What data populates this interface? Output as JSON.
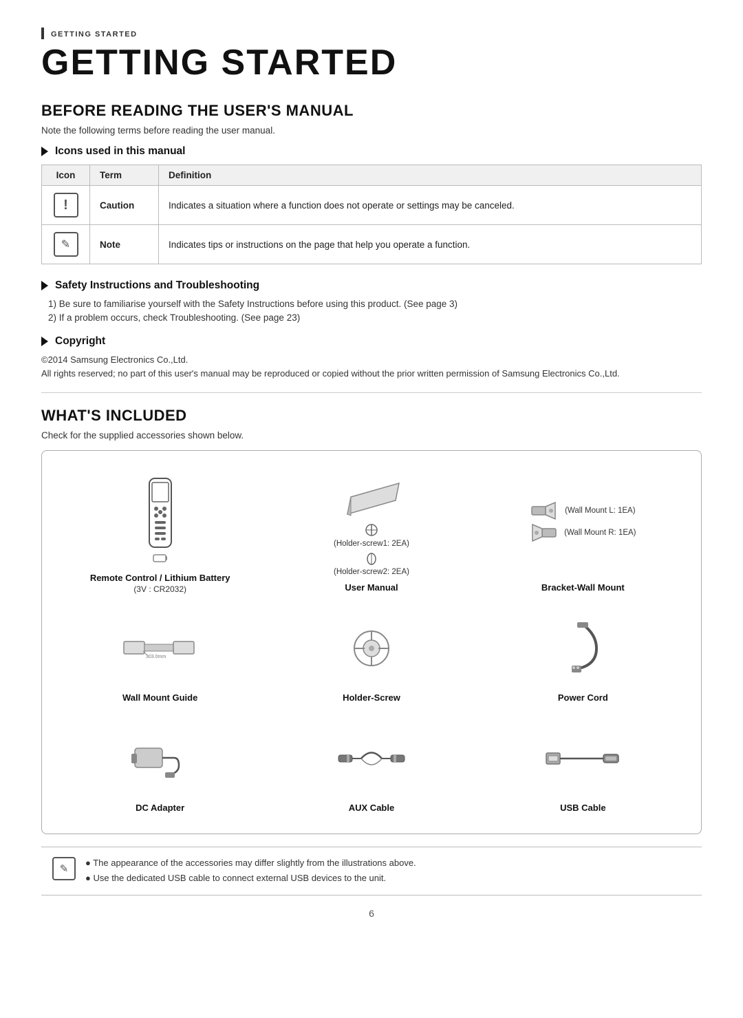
{
  "breadcrumb": "Getting Started",
  "page_title": "GETTING STARTED",
  "section1": {
    "title": "BEFORE READING THE USER'S MANUAL",
    "note": "Note the following terms before reading the user manual.",
    "icons_section": {
      "heading": "Icons used in this manual",
      "table": {
        "col_icon": "Icon",
        "col_term": "Term",
        "col_def": "Definition",
        "rows": [
          {
            "icon": "caution",
            "term": "Caution",
            "definition": "Indicates a situation where a function does not operate or settings may be canceled."
          },
          {
            "icon": "note",
            "term": "Note",
            "definition": "Indicates tips or instructions on the page that help you operate a function."
          }
        ]
      }
    },
    "safety_section": {
      "heading": "Safety Instructions and Troubleshooting",
      "items": [
        "1)  Be sure to familiarise yourself with the Safety Instructions before using this product. (See page 3)",
        "2)  If a problem occurs, check Troubleshooting. (See page 23)"
      ]
    },
    "copyright_section": {
      "heading": "Copyright",
      "line1": "©2014 Samsung Electronics Co.,Ltd.",
      "line2": "All rights reserved; no part of this user's manual may be reproduced or copied without the prior written permission of Samsung Electronics Co.,Ltd."
    }
  },
  "section2": {
    "title": "WHAT'S INCLUDED",
    "note": "Check for the supplied accessories shown below.",
    "items": [
      {
        "id": "remote-control",
        "label": "Remote Control / Lithium Battery",
        "sublabel": "(3V : CR2032)"
      },
      {
        "id": "user-manual",
        "label": "User Manual",
        "sublabel": ""
      },
      {
        "id": "bracket-wall-mount",
        "label": "Bracket-Wall Mount",
        "sublabel": ""
      },
      {
        "id": "wall-mount-guide",
        "label": "Wall Mount Guide",
        "sublabel": ""
      },
      {
        "id": "holder-screw",
        "label": "Holder-Screw",
        "sublabel": ""
      },
      {
        "id": "power-cord",
        "label": "Power Cord",
        "sublabel": ""
      },
      {
        "id": "dc-adapter",
        "label": "DC Adapter",
        "sublabel": ""
      },
      {
        "id": "aux-cable",
        "label": "AUX Cable",
        "sublabel": ""
      },
      {
        "id": "usb-cable",
        "label": "USB Cable",
        "sublabel": ""
      }
    ],
    "wall_mount_labels": [
      "(Wall Mount L: 1EA)",
      "(Wall Mount R: 1EA)"
    ],
    "holder_labels": [
      "(Holder-screw1: 2EA)",
      "(Holder-screw2: 2EA)"
    ]
  },
  "note_box": {
    "bullets": [
      "The appearance of the accessories may differ slightly from the illustrations above.",
      "Use the dedicated USB cable to connect external USB devices to the unit."
    ]
  },
  "page_number": "6"
}
